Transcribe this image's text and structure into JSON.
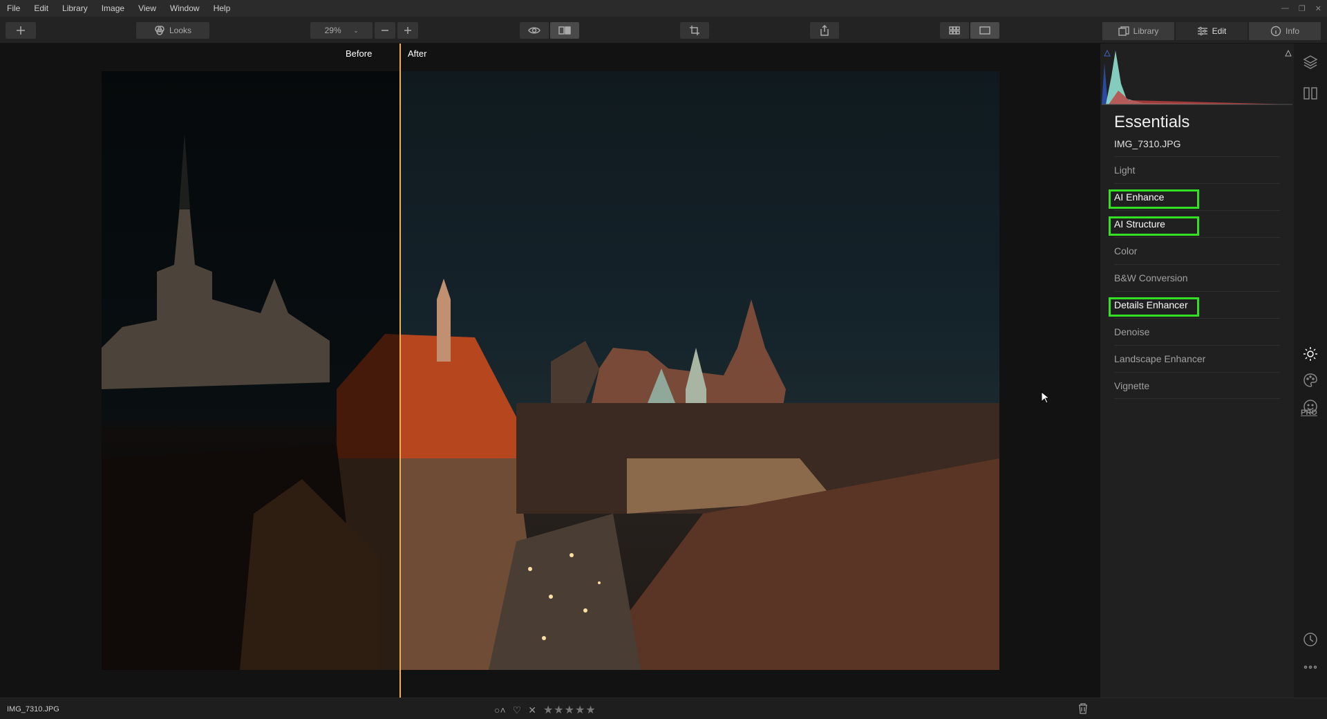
{
  "menu": [
    "File",
    "Edit",
    "Library",
    "Image",
    "View",
    "Window",
    "Help"
  ],
  "toolbar": {
    "looks_label": "Looks",
    "zoom_value": "29%"
  },
  "tabs": [
    {
      "label": "Library",
      "icon": "library-icon",
      "active": false
    },
    {
      "label": "Edit",
      "icon": "sliders-icon",
      "active": true
    },
    {
      "label": "Info",
      "icon": "info-icon",
      "active": false
    }
  ],
  "viewer": {
    "before_label": "Before",
    "after_label": "After"
  },
  "panel": {
    "title": "Essentials",
    "filename": "IMG_7310.JPG",
    "tools": [
      {
        "label": "Light",
        "highlighted": false
      },
      {
        "label": "AI Enhance",
        "highlighted": true
      },
      {
        "label": "AI Structure",
        "highlighted": true
      },
      {
        "label": "Color",
        "highlighted": false
      },
      {
        "label": "B&W Conversion",
        "highlighted": false
      },
      {
        "label": "Details Enhancer",
        "highlighted": true
      },
      {
        "label": "Denoise",
        "highlighted": false
      },
      {
        "label": "Landscape Enhancer",
        "highlighted": false
      },
      {
        "label": "Vignette",
        "highlighted": false
      }
    ],
    "pro_label": "PRO"
  },
  "status": {
    "filename": "IMG_7310.JPG",
    "stars": "★★★★★"
  },
  "colors": {
    "highlight": "#33e022",
    "split_line": "#f0b050"
  }
}
